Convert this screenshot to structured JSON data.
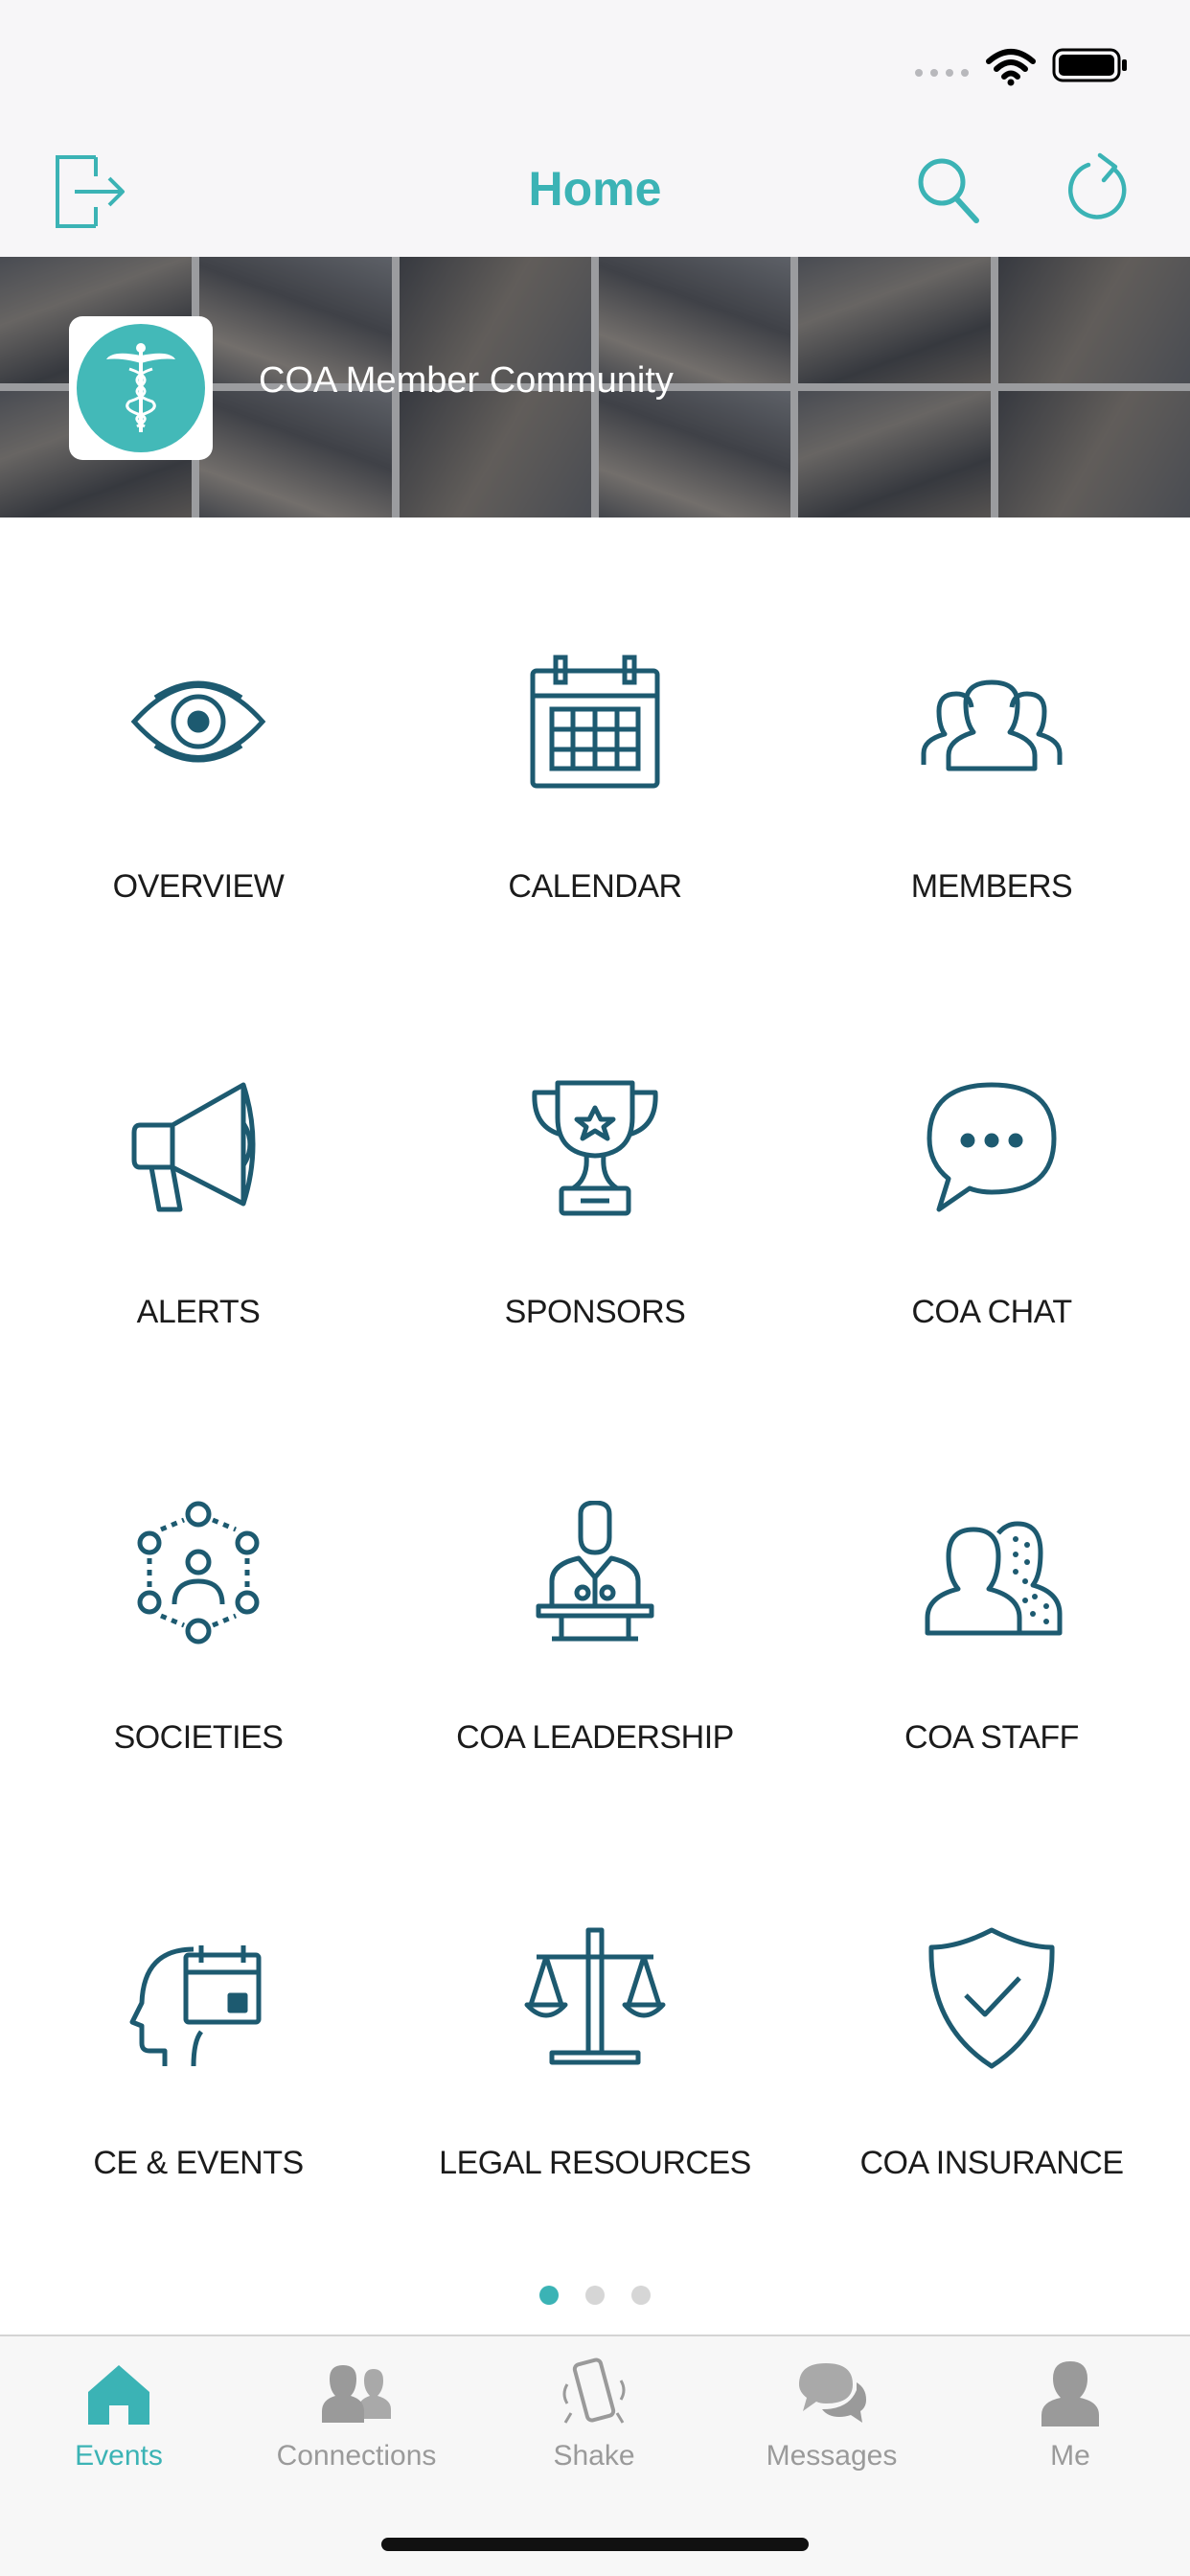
{
  "nav": {
    "title": "Home"
  },
  "banner": {
    "title": "COA Member Community"
  },
  "tiles": [
    {
      "label": "OVERVIEW",
      "icon": "eye-icon"
    },
    {
      "label": "CALENDAR",
      "icon": "calendar-icon"
    },
    {
      "label": "MEMBERS",
      "icon": "members-icon"
    },
    {
      "label": "ALERTS",
      "icon": "megaphone-icon"
    },
    {
      "label": "SPONSORS",
      "icon": "trophy-icon"
    },
    {
      "label": "COA CHAT",
      "icon": "chat-bubble-icon"
    },
    {
      "label": "SOCIETIES",
      "icon": "network-icon"
    },
    {
      "label": "COA LEADERSHIP",
      "icon": "speaker-podium-icon"
    },
    {
      "label": "COA STAFF",
      "icon": "staff-icon"
    },
    {
      "label": "CE & EVENTS",
      "icon": "head-calendar-icon"
    },
    {
      "label": "LEGAL RESOURCES",
      "icon": "scales-icon"
    },
    {
      "label": "COA INSURANCE",
      "icon": "shield-check-icon"
    }
  ],
  "pagination": {
    "pages": 3,
    "current": 1
  },
  "tabbar": {
    "items": [
      {
        "label": "Events",
        "icon": "home-icon",
        "active": true
      },
      {
        "label": "Connections",
        "icon": "people-icon",
        "active": false
      },
      {
        "label": "Shake",
        "icon": "shake-phone-icon",
        "active": false
      },
      {
        "label": "Messages",
        "icon": "chat-icon",
        "active": false
      },
      {
        "label": "Me",
        "icon": "person-icon",
        "active": false
      }
    ]
  },
  "colors": {
    "accent": "#3bb3b5",
    "icon_stroke": "#1d5a70",
    "inactive": "#9a9a9a"
  }
}
